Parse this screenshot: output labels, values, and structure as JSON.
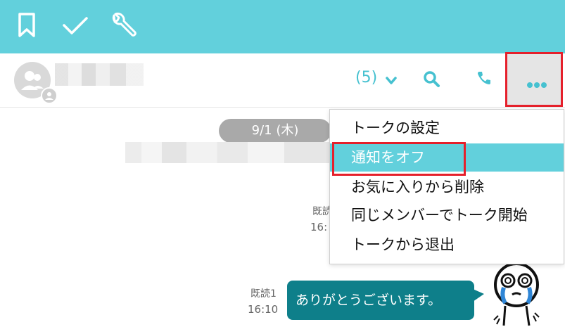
{
  "topbar": {
    "icons": [
      "bookmark-icon",
      "check-icon",
      "wrench-icon"
    ],
    "color": "#62d0dc"
  },
  "header": {
    "member_count": "(5)",
    "icons": [
      "search-icon",
      "phone-icon",
      "more-icon"
    ]
  },
  "chat": {
    "date": "9/1 (木)",
    "read_label_1": "既読",
    "time_1": "16:",
    "read_label_2": "既読1",
    "time_2": "16:10",
    "message": "ありがとうございます。",
    "bubble_color": "#0e7f8a"
  },
  "menu": {
    "items": [
      {
        "label": "トークの設定"
      },
      {
        "label": "通知をオフ"
      },
      {
        "label": "お気に入りから削除"
      },
      {
        "label": "同じメンバーでトーク開始"
      },
      {
        "label": "トークから退出"
      }
    ],
    "active_color": "#62d0dc",
    "highlight_color": "#e5202b"
  }
}
